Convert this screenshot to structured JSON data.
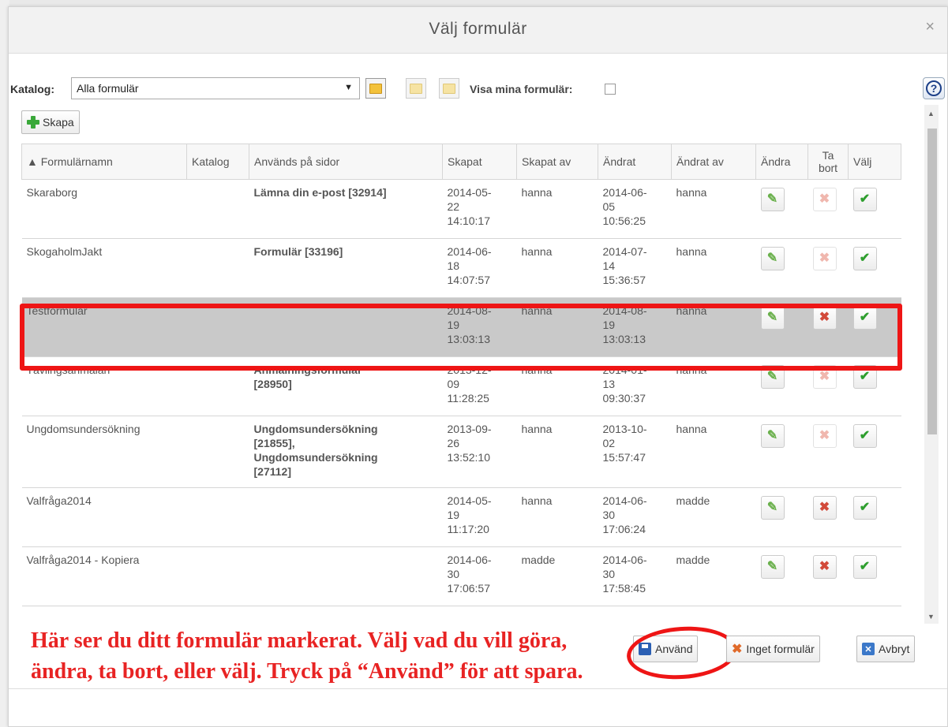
{
  "dialog": {
    "title": "Välj formulär",
    "close": "×"
  },
  "toolbar": {
    "katalog_label": "Katalog:",
    "katalog_value": "Alla formulär",
    "visa_label": "Visa mina formulär:",
    "help": "?"
  },
  "skapa_label": "Skapa",
  "table": {
    "headers": [
      "▲ Formulärnamn",
      "Katalog",
      "Används på sidor",
      "Skapat",
      "Skapat av",
      "Ändrat",
      "Ändrat av",
      "Ändra",
      "Ta bort",
      "Välj"
    ],
    "rows": [
      {
        "name": "Skaraborg",
        "katalog": "",
        "pages": [
          "Lämna din e-post [32914]"
        ],
        "skapat": [
          "2014-05-",
          "22",
          "14:10:17"
        ],
        "skapat_av": "hanna",
        "andrat": [
          "2014-06-",
          "05",
          "10:56:25"
        ],
        "andrat_av": "hanna",
        "can_delete": false,
        "selected": false
      },
      {
        "name": "SkogaholmJakt",
        "katalog": "",
        "pages": [
          "Formulär [33196]"
        ],
        "skapat": [
          "2014-06-",
          "18",
          "14:07:57"
        ],
        "skapat_av": "hanna",
        "andrat": [
          "2014-07-",
          "14",
          "15:36:57"
        ],
        "andrat_av": "hanna",
        "can_delete": false,
        "selected": false
      },
      {
        "name": "Testformulär",
        "katalog": "",
        "pages": [],
        "skapat": [
          "2014-08-",
          "19",
          "13:03:13"
        ],
        "skapat_av": "hanna",
        "andrat": [
          "2014-08-",
          "19",
          "13:03:13"
        ],
        "andrat_av": "hanna",
        "can_delete": true,
        "selected": true
      },
      {
        "name": "Tävlingsanmälan",
        "katalog": "",
        "pages": [
          "Anmälningsformulär",
          "[28950]"
        ],
        "skapat": [
          "2013-12-",
          "09",
          "11:28:25"
        ],
        "skapat_av": "hanna",
        "andrat": [
          "2014-01-",
          "13",
          "09:30:37"
        ],
        "andrat_av": "hanna",
        "can_delete": false,
        "selected": false
      },
      {
        "name": "Ungdomsundersökning",
        "katalog": "",
        "pages": [
          "Ungdomsundersökning",
          "[21855],",
          "Ungdomsundersökning",
          "[27112]"
        ],
        "skapat": [
          "2013-09-",
          "26",
          "13:52:10"
        ],
        "skapat_av": "hanna",
        "andrat": [
          "2013-10-",
          "02",
          "15:57:47"
        ],
        "andrat_av": "hanna",
        "can_delete": false,
        "selected": false
      },
      {
        "name": "Valfråga2014",
        "katalog": "",
        "pages": [],
        "skapat": [
          "2014-05-",
          "19",
          "11:17:20"
        ],
        "skapat_av": "hanna",
        "andrat": [
          "2014-06-",
          "30",
          "17:06:24"
        ],
        "andrat_av": "madde",
        "can_delete": true,
        "selected": false
      },
      {
        "name": "Valfråga2014 - Kopiera",
        "katalog": "",
        "pages": [],
        "skapat": [
          "2014-06-",
          "30",
          "17:06:57"
        ],
        "skapat_av": "madde",
        "andrat": [
          "2014-06-",
          "30",
          "17:58:45"
        ],
        "andrat_av": "madde",
        "can_delete": true,
        "selected": false
      }
    ]
  },
  "annotation": "Här ser du ditt formulär markerat. Välj vad du vill göra, ändra, ta bort, eller välj. Tryck på “Använd” för att spara.",
  "buttons": {
    "anvand": "Använd",
    "inget": "Inget formulär",
    "avbryt": "Avbryt"
  },
  "icons": {
    "edit": "pencil-icon",
    "delete": "delete-x-icon",
    "select": "checkmark-icon"
  },
  "colors": {
    "highlight": "#ee1515",
    "selected_row": "#c9c9c9",
    "annotation": "#e82323"
  }
}
